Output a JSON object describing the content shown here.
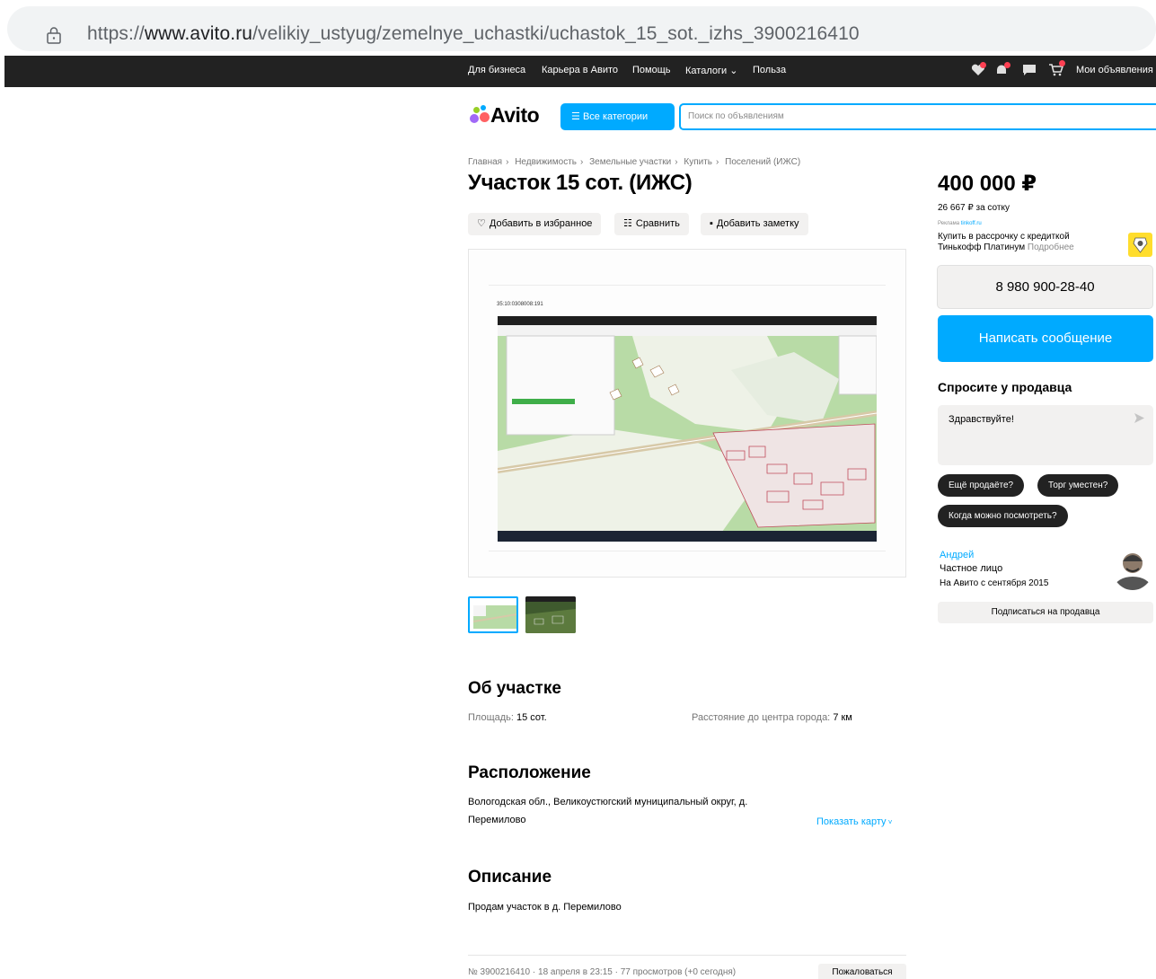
{
  "browser": {
    "url_scheme": "https://",
    "url_host": "www.avito.ru",
    "url_path": "/velikiy_ustyug/zemelnye_uchastki/uchastok_15_sot._izhs_3900216410"
  },
  "topnav": {
    "links": [
      "Для бизнеса",
      "Карьера в Авито",
      "Помощь",
      "Каталоги",
      "Польза"
    ],
    "my_ads": "Мои объявления"
  },
  "header": {
    "logo": "Avito",
    "categories_button": "Все категории",
    "search_placeholder": "Поиск по объявлениям"
  },
  "breadcrumbs": [
    "Главная",
    "Недвижимость",
    "Земельные участки",
    "Купить",
    "Поселений (ИЖС)"
  ],
  "listing": {
    "title": "Участок 15 сот. (ИЖС)",
    "actions": {
      "favorite": "Добавить в избранное",
      "compare": "Сравнить",
      "note": "Добавить заметку"
    },
    "cadastral_label": "35:10:0308008:191",
    "about": {
      "heading": "Об участке",
      "area_label": "Площадь:",
      "area_value": "15 сот.",
      "distance_label": "Расстояние до центра города:",
      "distance_value": "7 км"
    },
    "location": {
      "heading": "Расположение",
      "line1": "Вологодская обл., Великоустюгский муниципальный округ, д.",
      "line2": "Перемилово",
      "show_map": "Показать карту"
    },
    "description": {
      "heading": "Описание",
      "text": "Продам участок в д. Перемилово"
    },
    "footer": {
      "meta": "№ 3900216410 · 18 апреля в 23:15 · 77 просмотров (+0 сегодня)",
      "report": "Пожаловаться"
    }
  },
  "sidebar": {
    "price": "400 000 ₽",
    "price_per": "26 667 ₽ за сотку",
    "ad_label": "Реклама",
    "ad_domain": "tinkoff.ru",
    "credit_line1": "Купить в рассрочку с кредиткой",
    "credit_line2": "Тинькофф Платинум",
    "credit_more": "Подробнее",
    "phone": "8 980 900-28-40",
    "message_button": "Написать сообщение",
    "ask_title": "Спросите у продавца",
    "ask_text": "Здравствуйте!",
    "chips": [
      "Ещё продаёте?",
      "Торг уместен?",
      "Когда можно посмотреть?"
    ],
    "seller": {
      "name": "Андрей",
      "type": "Частное лицо",
      "since": "На Авито с сентября 2015",
      "subscribe": "Подписаться на продавца"
    }
  },
  "colors": {
    "accent": "#00aaff",
    "dark": "#222222",
    "button_bg": "#f2f1f0",
    "notification": "#ff4053"
  }
}
